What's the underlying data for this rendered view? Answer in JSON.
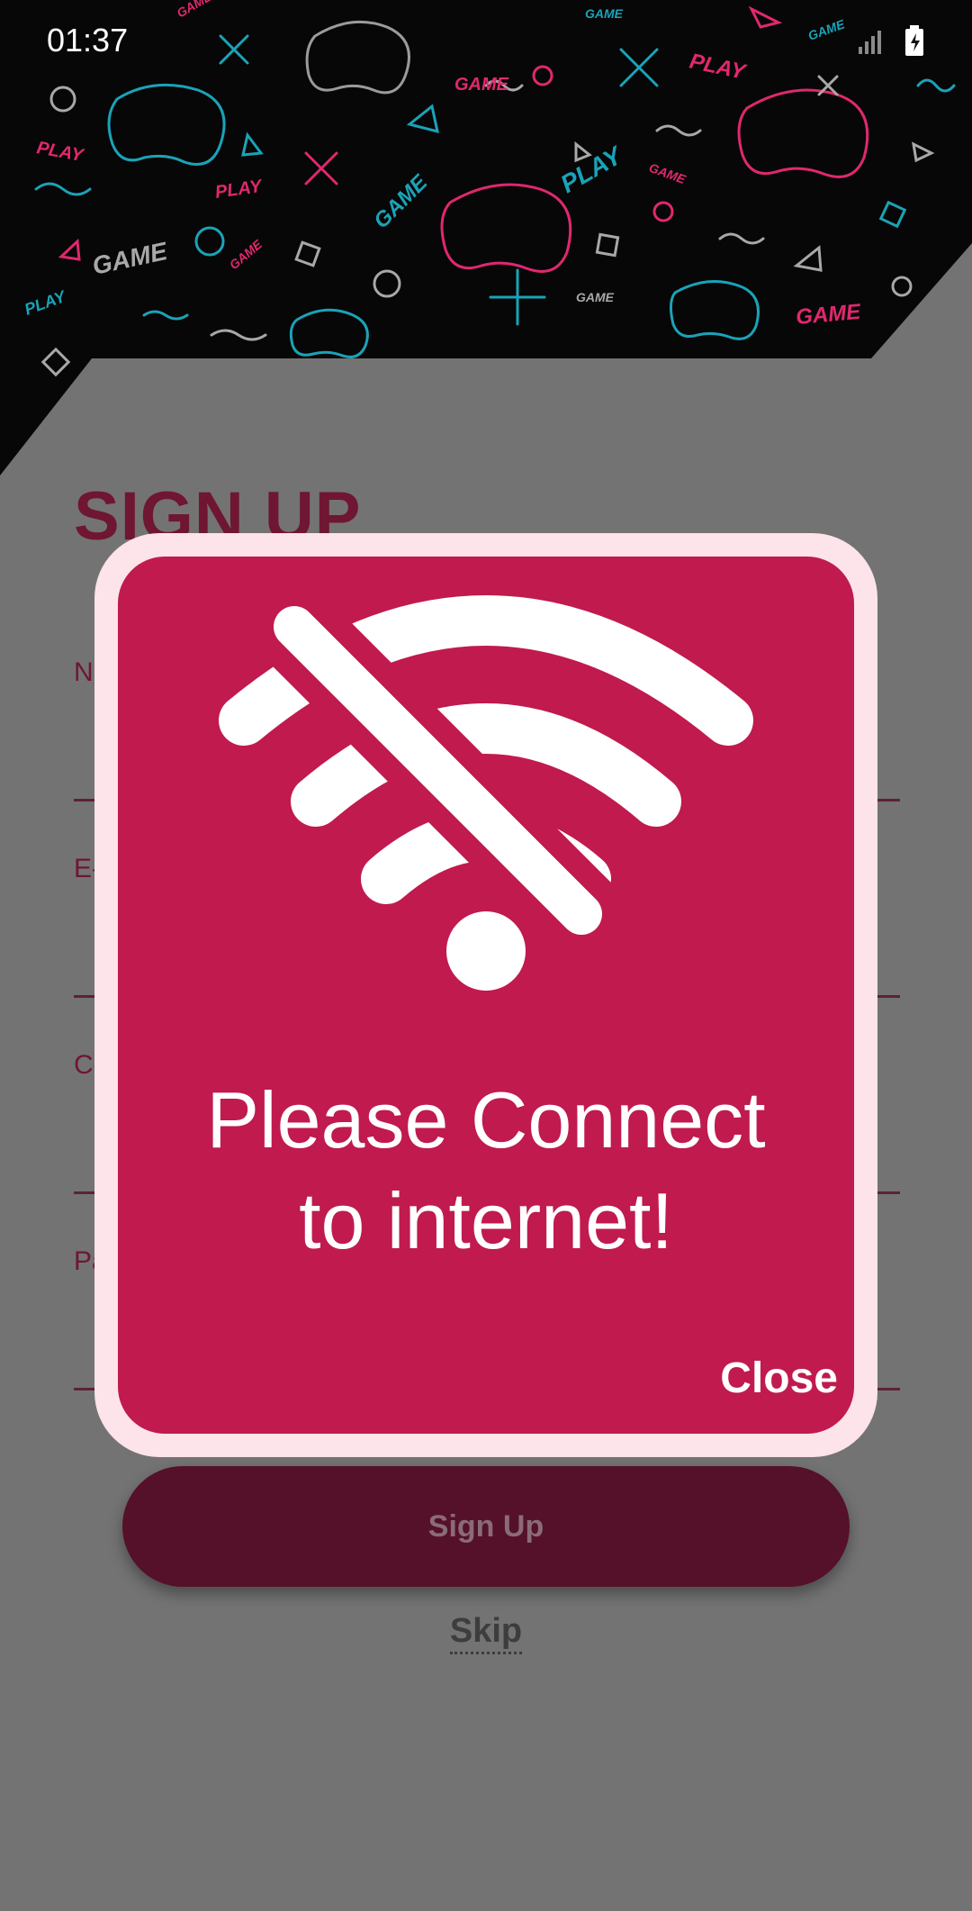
{
  "status_bar": {
    "time": "01:37",
    "icons": [
      "signal-icon",
      "battery-charging-icon"
    ]
  },
  "header": {
    "pattern_words": [
      "PLAY",
      "GAME",
      "PLAY",
      "GAME",
      "PLAY",
      "GAME",
      "PLAY",
      "GAME",
      "GAME",
      "PLAY",
      "GAME",
      "GAME"
    ],
    "colors": {
      "pink": "#e0286e",
      "teal": "#1aa3b8",
      "gray": "#a8a8a8",
      "bg": "#070707"
    }
  },
  "signup_form": {
    "title": "SIGN UP",
    "fields": [
      {
        "label": "Name"
      },
      {
        "label": "E-mail"
      },
      {
        "label": "Contact"
      },
      {
        "label": "Password"
      }
    ],
    "submit_label": "Sign Up",
    "skip_label": "Skip"
  },
  "dialog": {
    "icon": "wifi-off-icon",
    "message_line1": "Please Connect",
    "message_line2": "to internet!",
    "close_label": "Close",
    "colors": {
      "frame": "#fde3ea",
      "panel": "#c01a4e",
      "text": "#ffffff"
    }
  }
}
